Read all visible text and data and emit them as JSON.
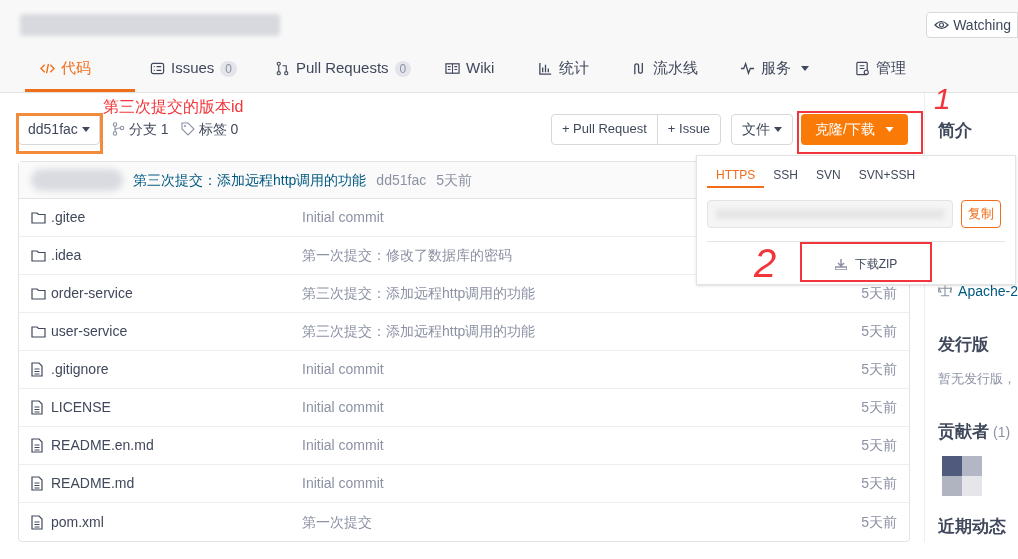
{
  "header": {
    "watch_button": "Watching"
  },
  "tabs": [
    {
      "label": "代码",
      "selected": true
    },
    {
      "label": "Issues",
      "count": "0",
      "selected": false
    },
    {
      "label": "Pull Requests",
      "count": "0",
      "selected": false
    },
    {
      "label": "Wiki",
      "selected": false
    },
    {
      "label": "统计",
      "selected": false
    },
    {
      "label": "流水线",
      "selected": false
    },
    {
      "label": "服务",
      "dropdown": true,
      "selected": false
    },
    {
      "label": "管理",
      "selected": false
    }
  ],
  "toolbar": {
    "branch": "dd51fac",
    "branches": "分支 1",
    "tags": "标签 0",
    "buttons": [
      "+ Pull Request",
      "+ Issue"
    ],
    "file_menu": "文件",
    "clone_button": "克隆/下载"
  },
  "latest_commit": {
    "message": "第三次提交：添加远程http调用的功能",
    "hash": "dd51fac",
    "time": "5天前"
  },
  "files": [
    {
      "kind": "folder",
      "name": ".gitee",
      "commit": "Initial commit"
    },
    {
      "kind": "folder",
      "name": ".idea",
      "commit": "第一次提交：修改了数据库的密码"
    },
    {
      "kind": "folder",
      "name": "order-service",
      "commit": "第三次提交：添加远程http调用的功能",
      "time": "5天前"
    },
    {
      "kind": "folder",
      "name": "user-service",
      "commit": "第三次提交：添加远程http调用的功能",
      "time": "5天前"
    },
    {
      "kind": "file",
      "name": ".gitignore",
      "commit": "Initial commit",
      "time": "5天前"
    },
    {
      "kind": "file",
      "name": "LICENSE",
      "commit": "Initial commit",
      "time": "5天前"
    },
    {
      "kind": "file",
      "name": "README.en.md",
      "commit": "Initial commit",
      "time": "5天前"
    },
    {
      "kind": "file",
      "name": "README.md",
      "commit": "Initial commit",
      "time": "5天前"
    },
    {
      "kind": "file",
      "name": "pom.xml",
      "commit": "第一次提交",
      "time": "5天前"
    }
  ],
  "clone_popup": {
    "tabs": [
      {
        "label": "HTTPS",
        "selected": true
      },
      {
        "label": "SSH",
        "selected": false
      },
      {
        "label": "SVN",
        "selected": false
      },
      {
        "label": "SVN+SSH",
        "selected": false
      }
    ],
    "copy_button": "复制",
    "download_button": "下载ZIP"
  },
  "sidebar": {
    "intro_title": "简介",
    "license": "Apache-2",
    "releases_title": "发行版",
    "releases_text": "暂无发行版，",
    "contributors_title": "贡献者",
    "contributors_count": "(1)",
    "activity_title": "近期动态"
  },
  "annotations": [
    {
      "kind": "label",
      "text": "第三次提交的版本id"
    },
    {
      "kind": "number",
      "text": "1"
    },
    {
      "kind": "number",
      "text": "2"
    }
  ]
}
